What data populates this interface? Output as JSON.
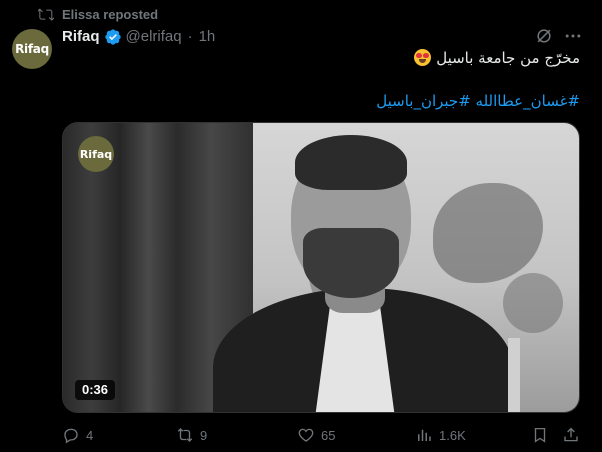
{
  "repost": {
    "label": "Elissa reposted",
    "icon": "repost-icon"
  },
  "author": {
    "avatar_text": "Rifaq",
    "name": "Rifaq",
    "verified": true,
    "handle": "@elrifaq",
    "separator": "·",
    "time": "1h",
    "avatar_color": "#6b6a3c"
  },
  "post": {
    "text": "مخرّج من جامعة باسيل",
    "emoji": "star-struck-emoji",
    "hashtags": "#غسان_عطاالله #جبران_باسيل"
  },
  "media": {
    "watermark_text": "Rifaq",
    "duration": "0:36"
  },
  "actions": {
    "replies": "4",
    "reposts": "9",
    "likes": "65",
    "views": "1.6K"
  },
  "colors": {
    "background": "#000000",
    "text": "#e7e9ea",
    "muted": "#71767b",
    "link": "#1d9bf0",
    "verified": "#1d9bf0"
  }
}
